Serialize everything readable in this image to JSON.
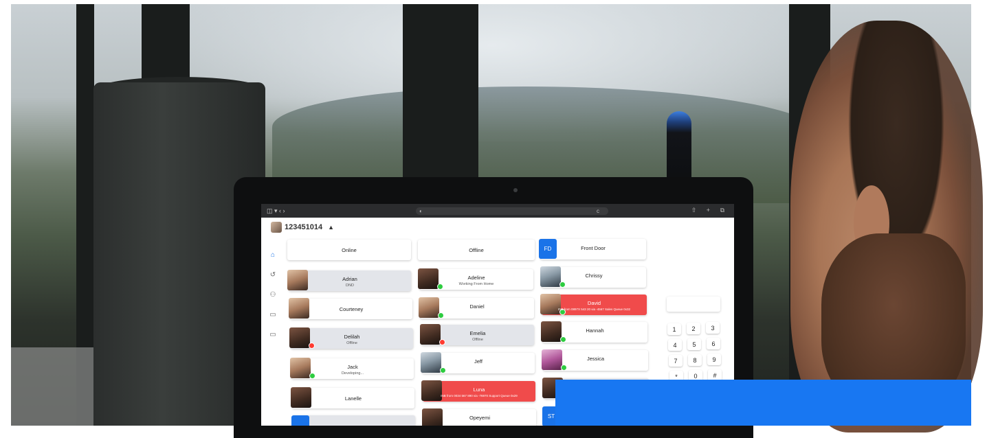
{
  "browser": {
    "nav_icons": "◫ ▾  ‹  ›",
    "secure_icon": "◐",
    "reload_icon": "c",
    "right_icons": "⇧ + ⧉"
  },
  "header": {
    "user_id": "123451014",
    "bell_icon": "bell-icon"
  },
  "nav": [
    {
      "icon": "home-icon",
      "glyph": "⌂"
    },
    {
      "icon": "history-icon",
      "glyph": "↺"
    },
    {
      "icon": "contacts-icon",
      "glyph": "⚇"
    },
    {
      "icon": "chat-icon",
      "glyph": "▭"
    },
    {
      "icon": "video-icon",
      "glyph": "▭"
    }
  ],
  "groups": {
    "online": "Online",
    "offline": "Offline",
    "front_door_badge": "FD",
    "front_door": "Front Door"
  },
  "contacts": {
    "adrian": {
      "name": "Adrian",
      "status": "DND"
    },
    "adeline": {
      "name": "Adeline",
      "status": "Working From Home"
    },
    "chrissy": {
      "name": "Chrissy"
    },
    "courteney": {
      "name": "Courteney"
    },
    "daniel": {
      "name": "Daniel"
    },
    "david": {
      "name": "David",
      "status": "INB from 0897X 543 20 via -4567 Sales Queue 0x32"
    },
    "delilah": {
      "name": "Delilah",
      "status": "Offline"
    },
    "emelia": {
      "name": "Emelia",
      "status": "Offline"
    },
    "hannah": {
      "name": "Hannah"
    },
    "jack": {
      "name": "Jack",
      "status": "Developing..."
    },
    "jeff": {
      "name": "Jeff"
    },
    "jessica": {
      "name": "Jessica"
    },
    "lanelle": {
      "name": "Lanelle"
    },
    "luna": {
      "name": "Luna",
      "status": "INB from 0034 567 890 via -76970 Support Queue 0x29"
    },
    "opeyemi": {
      "name": "Opeyemi"
    }
  },
  "partial_badge": "ST",
  "keypad": [
    "1",
    "2",
    "3",
    "4",
    "5",
    "6",
    "7",
    "8",
    "9",
    "*",
    "0",
    "#"
  ],
  "colors": {
    "accent": "#1a73e8",
    "busy": "#f04b4b",
    "online_dot": "#2ecc40",
    "overlay": "#1877f2"
  }
}
